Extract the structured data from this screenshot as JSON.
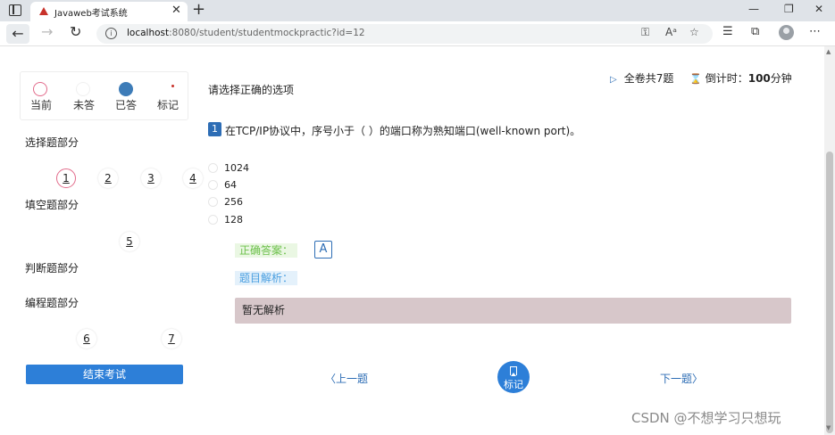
{
  "browser": {
    "tab_title": "Javaweb考试系统",
    "tab_close": "✕",
    "new_tab": "+",
    "minimize": "—",
    "maximize": "❐",
    "close": "✕",
    "url_host": "localhost",
    "url_rest": ":8080/student/studentmockpractic?id=12"
  },
  "legend": {
    "current": "当前",
    "unanswered": "未答",
    "answered": "已答",
    "marked": "标记"
  },
  "sidebar": {
    "choice_title": "选择题部分",
    "choice_numbers": [
      "1",
      "2",
      "3",
      "4"
    ],
    "fill_title": "填空题部分",
    "fill_numbers": [
      "5"
    ],
    "judge_title": "判断题部分",
    "program_title": "编程题部分",
    "program_numbers": [
      "6",
      "7"
    ],
    "end_button": "结束考试"
  },
  "header": {
    "instruction": "请选择正确的选项",
    "total": "全卷共7题",
    "timer_label": "倒计时：",
    "timer_value": "100",
    "timer_unit": "分钟"
  },
  "question": {
    "index": "1",
    "text": "在TCP/IP协议中，序号小于（ ）的端口称为熟知端口(well-known port)。",
    "options": [
      "1024",
      "64",
      "256",
      "128"
    ]
  },
  "answer": {
    "label": "正确答案：",
    "value": "A",
    "explanation_label": "题目解析：",
    "explanation_text": "暂无解析"
  },
  "nav": {
    "prev": "上一题",
    "next": "下一题",
    "mark": "标记"
  },
  "watermark": "CSDN @不想学习只想玩",
  "colors": {
    "accent": "#2d7fd8",
    "answered": "#3d7cb8",
    "current_ring": "#e26b8b",
    "correct_green": "#6cc04a",
    "explain_blue": "#4a9fe0",
    "explain_box": "#d7c7ca"
  }
}
